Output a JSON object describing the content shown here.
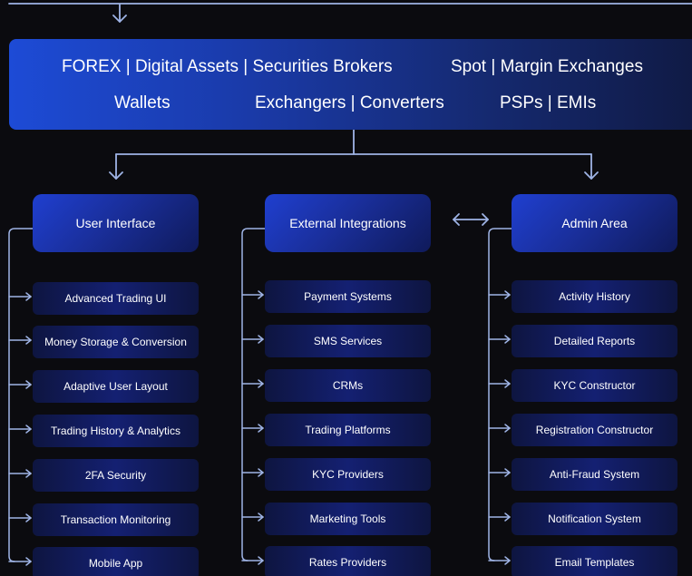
{
  "banner": {
    "row1": [
      "FOREX | Digital Assets | Securities Brokers",
      "Spot | Margin Exchanges"
    ],
    "row2": [
      "Wallets",
      "Exchangers | Converters",
      "PSPs | EMIs"
    ]
  },
  "columns": [
    {
      "title": "User Interface",
      "items": [
        "Advanced Trading UI",
        "Money Storage & Conversion",
        "Adaptive User Layout",
        "Trading History & Analytics",
        "2FA Security",
        "Transaction Monitoring",
        "Mobile App"
      ]
    },
    {
      "title": "External Integrations",
      "items": [
        "Payment Systems",
        "SMS Services",
        "CRMs",
        "Trading Platforms",
        "KYC Providers",
        "Marketing Tools",
        "Rates Providers"
      ]
    },
    {
      "title": "Admin Area",
      "items": [
        "Activity History",
        "Detailed Reports",
        "KYC Constructor",
        "Registration Constructor",
        "Anti-Fraud System",
        "Notification System",
        "Email Templates"
      ]
    }
  ],
  "colors": {
    "connector": "#9fb4e6",
    "accent": "#1f3fd0"
  }
}
